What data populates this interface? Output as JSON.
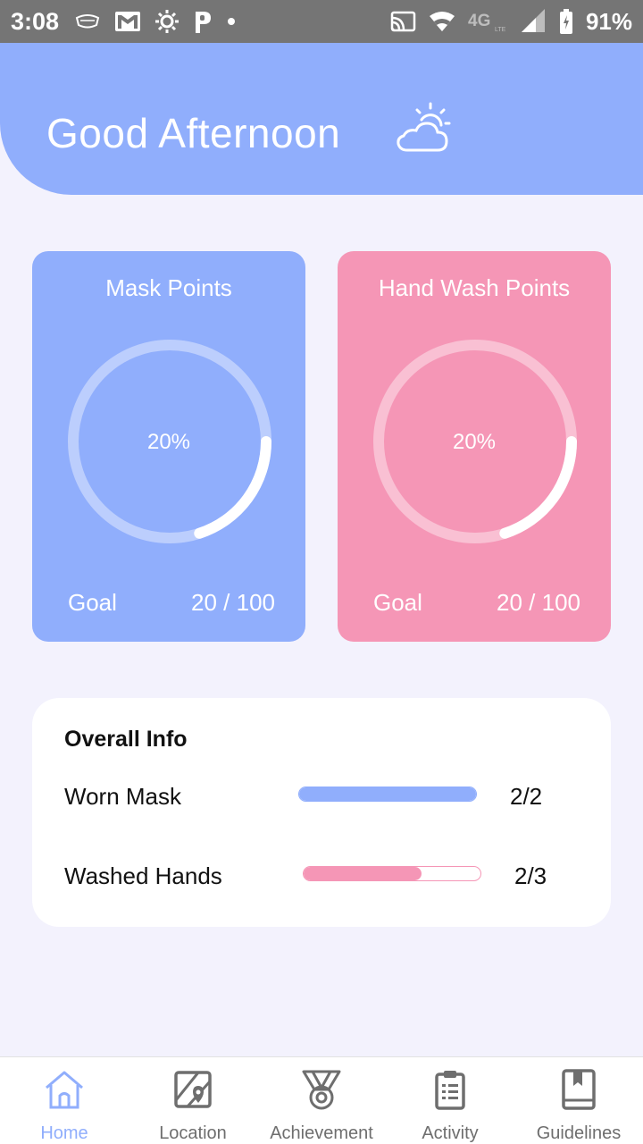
{
  "status_bar": {
    "time": "3:08",
    "battery": "91%",
    "network": "4G"
  },
  "header": {
    "greeting": "Good Afternoon",
    "weather_icon": "partly-cloudy-icon"
  },
  "cards": [
    {
      "title": "Mask Points",
      "percent_label": "20%",
      "progress": 0.2,
      "goal_label": "Goal",
      "goal_value": "20 / 100",
      "color": "#90aefc"
    },
    {
      "title": "Hand Wash Points",
      "percent_label": "20%",
      "progress": 0.2,
      "goal_label": "Goal",
      "goal_value": "20 / 100",
      "color": "#f596b6"
    }
  ],
  "overall_info": {
    "title": "Overall Info",
    "rows": [
      {
        "label": "Worn Mask",
        "value": "2/2",
        "progress": 1.0,
        "color": "#90aefc"
      },
      {
        "label": "Washed Hands",
        "value": "2/3",
        "progress": 0.667,
        "color": "#f596b6"
      }
    ]
  },
  "bottom_nav": {
    "items": [
      {
        "label": "Home",
        "icon": "home-icon",
        "active": true
      },
      {
        "label": "Location",
        "icon": "map-icon",
        "active": false
      },
      {
        "label": "Achievement",
        "icon": "medal-icon",
        "active": false
      },
      {
        "label": "Activity",
        "icon": "clipboard-icon",
        "active": false
      },
      {
        "label": "Guidelines",
        "icon": "book-icon",
        "active": false
      }
    ]
  },
  "colors": {
    "primary": "#90aefc",
    "secondary": "#f596b6",
    "background": "#f3f2fd",
    "nav_inactive": "#6e6e6e"
  }
}
